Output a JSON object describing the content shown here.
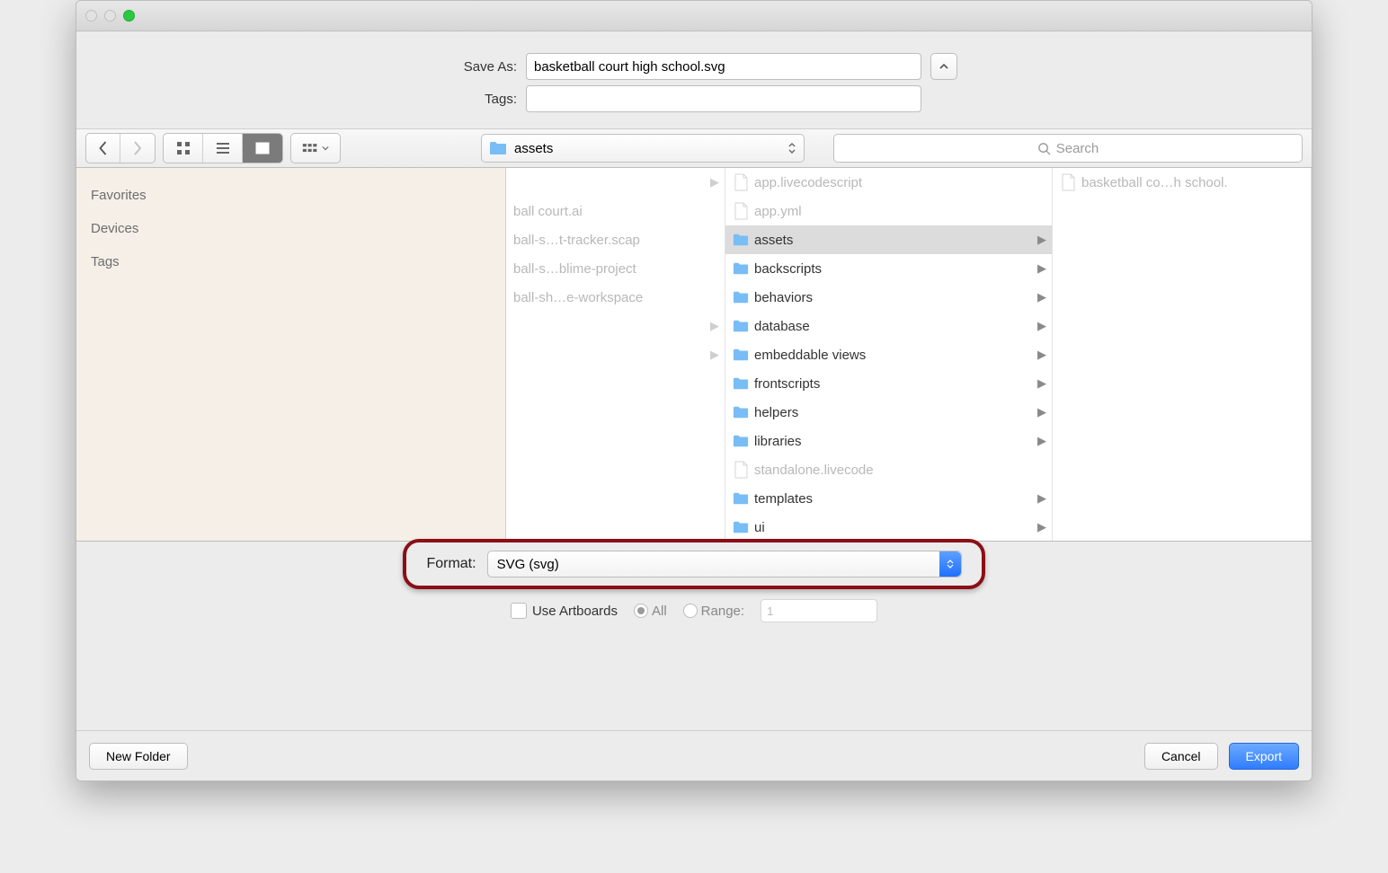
{
  "form": {
    "saveAsLabel": "Save As:",
    "saveAsValue": "basketball court high school.svg",
    "tagsLabel": "Tags:",
    "tagsValue": ""
  },
  "toolbar": {
    "currentFolder": "assets",
    "searchPlaceholder": "Search"
  },
  "sidebar": {
    "favorites": "Favorites",
    "devices": "Devices",
    "tags": "Tags"
  },
  "col1": {
    "items": [
      {
        "label": "",
        "arrow": true,
        "dim": true
      },
      {
        "label": "ball court.ai",
        "arrow": false,
        "dim": true
      },
      {
        "label": "ball-s…t-tracker.scap",
        "arrow": false,
        "dim": true
      },
      {
        "label": "ball-s…blime-project",
        "arrow": false,
        "dim": true
      },
      {
        "label": "ball-sh…e-workspace",
        "arrow": false,
        "dim": true
      },
      {
        "label": "",
        "arrow": true,
        "dim": true
      },
      {
        "label": "",
        "arrow": true,
        "dim": true
      }
    ]
  },
  "col2": {
    "items": [
      {
        "label": "app.livecodescript",
        "type": "doc",
        "dim": true,
        "arrow": false
      },
      {
        "label": "app.yml",
        "type": "doc",
        "dim": true,
        "arrow": false
      },
      {
        "label": "assets",
        "type": "folder",
        "dim": false,
        "arrow": true,
        "selected": true
      },
      {
        "label": "backscripts",
        "type": "folder",
        "dim": false,
        "arrow": true
      },
      {
        "label": "behaviors",
        "type": "folder",
        "dim": false,
        "arrow": true
      },
      {
        "label": "database",
        "type": "folder",
        "dim": false,
        "arrow": true
      },
      {
        "label": "embeddable views",
        "type": "folder",
        "dim": false,
        "arrow": true
      },
      {
        "label": "frontscripts",
        "type": "folder",
        "dim": false,
        "arrow": true
      },
      {
        "label": "helpers",
        "type": "folder",
        "dim": false,
        "arrow": true
      },
      {
        "label": "libraries",
        "type": "folder",
        "dim": false,
        "arrow": true
      },
      {
        "label": "standalone.livecode",
        "type": "doc",
        "dim": true,
        "arrow": false
      },
      {
        "label": "templates",
        "type": "folder",
        "dim": false,
        "arrow": true
      },
      {
        "label": "ui",
        "type": "folder",
        "dim": false,
        "arrow": true
      }
    ]
  },
  "col3": {
    "items": [
      {
        "label": "basketball co…h school.",
        "type": "doc",
        "dim": true
      }
    ]
  },
  "format": {
    "label": "Format:",
    "value": "SVG (svg)"
  },
  "artboards": {
    "useLabel": "Use Artboards",
    "allLabel": "All",
    "rangeLabel": "Range:",
    "rangeValue": "1"
  },
  "footer": {
    "newFolder": "New Folder",
    "cancel": "Cancel",
    "export": "Export"
  }
}
